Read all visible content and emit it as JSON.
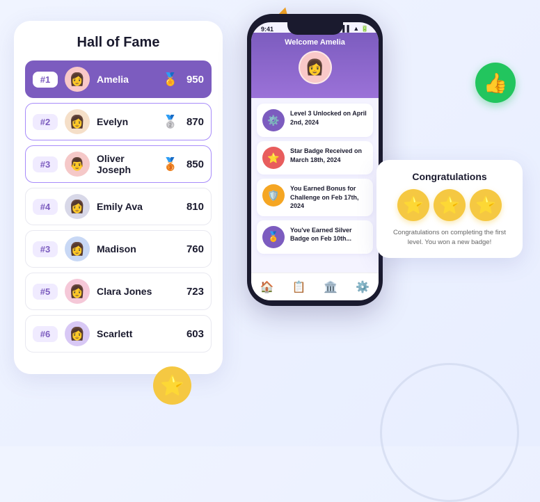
{
  "page": {
    "background": "#f0f4ff"
  },
  "hall_of_fame": {
    "title": "Hall of Fame",
    "rows": [
      {
        "rank": "#1",
        "name": "Amelia",
        "score": "950",
        "medal": "🏅",
        "isTop": true,
        "avatar": "👩"
      },
      {
        "rank": "#2",
        "name": "Evelyn",
        "score": "870",
        "medal": "🥈",
        "isTop": false,
        "avatar": "👩"
      },
      {
        "rank": "#3",
        "name": "Oliver Joseph",
        "score": "850",
        "medal": "🥉",
        "isTop": false,
        "avatar": "👨"
      },
      {
        "rank": "#4",
        "name": "Emily Ava",
        "score": "810",
        "medal": "",
        "isTop": false,
        "avatar": "👩"
      },
      {
        "rank": "#3",
        "name": "Madison",
        "score": "760",
        "medal": "",
        "isTop": false,
        "avatar": "👩"
      },
      {
        "rank": "#5",
        "name": "Clara Jones",
        "score": "723",
        "medal": "",
        "isTop": false,
        "avatar": "👩"
      },
      {
        "rank": "#6",
        "name": "Scarlett",
        "score": "603",
        "medal": "",
        "isTop": false,
        "avatar": "👩"
      }
    ]
  },
  "phone": {
    "status_time": "9:41",
    "welcome": "Welcome Amelia",
    "activities": [
      {
        "icon": "⚙️",
        "text": "Level 3 Unlocked\non April 2nd, 2024",
        "color": "#7c5cbf"
      },
      {
        "icon": "⭐",
        "text": "Star Badge Received\non March 18th, 2024",
        "color": "#e85d5d"
      },
      {
        "icon": "🛡️",
        "text": "You Earned Bonus\nfor Challenge on\nFeb 17th, 2024",
        "color": "#f5a623"
      },
      {
        "icon": "🏅",
        "text": "You've Earned Silver\nBadge on Feb 10th...",
        "color": "#7c5cbf"
      }
    ],
    "nav_items": [
      "🏠",
      "📋",
      "🏛️",
      "⚙️"
    ]
  },
  "congratulations": {
    "title": "Congratulations",
    "stars_count": 3,
    "text": "Congratulations on completing the first level. You won a new badge!"
  },
  "decorative": {
    "thumbs_up": "👍",
    "star": "⭐",
    "triangle_color": "#f5a623"
  }
}
